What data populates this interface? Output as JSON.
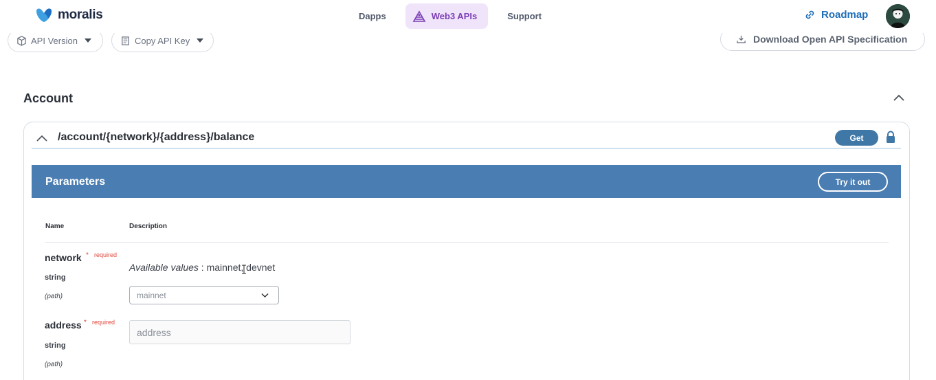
{
  "header": {
    "brand": "moralis",
    "nav": [
      {
        "label": "Dapps",
        "active": false
      },
      {
        "label": "Web3 APIs",
        "active": true
      },
      {
        "label": "Support",
        "active": false
      }
    ],
    "roadmap_label": "Roadmap"
  },
  "toolbar": {
    "api_version_label": "API Version",
    "copy_key_label": "Copy API Key",
    "download_label": "Download Open API Specification"
  },
  "section": {
    "title": "Account"
  },
  "endpoint": {
    "path": "/account/{network}/{address}/balance",
    "method": "Get"
  },
  "parameters": {
    "title": "Parameters",
    "try_label": "Try it out",
    "col_name": "Name",
    "col_description": "Description",
    "items": [
      {
        "name": "network",
        "required_marker": "*",
        "required_label": "required",
        "type": "string",
        "in": "(path)",
        "available_prefix": "Available values",
        "available_values": " : mainnet, devnet",
        "selected_value": "mainnet"
      },
      {
        "name": "address",
        "required_marker": "*",
        "required_label": "required",
        "type": "string",
        "in": "(path)",
        "placeholder": "address"
      }
    ]
  },
  "colors": {
    "accent_blue": "#4a7db2",
    "method_badge": "#3f77a6",
    "nav_active_bg": "#f0e4fa",
    "nav_active_text": "#7b3fb5",
    "required_red": "#e0453a"
  },
  "icons": [
    "moralis-logo-icon",
    "web3-apis-icon",
    "link-icon",
    "cube-icon",
    "document-icon",
    "download-icon",
    "chevron-up-icon",
    "lock-icon",
    "chevron-down-icon",
    "text-cursor-icon"
  ]
}
